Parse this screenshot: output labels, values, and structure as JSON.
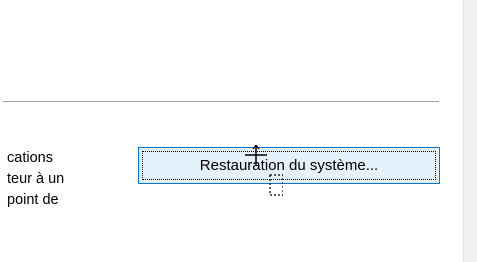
{
  "description": {
    "lines": [
      "cations",
      "teur à un",
      "point de"
    ]
  },
  "buttons": {
    "system_restore": "Restauration du système..."
  },
  "cursor": {
    "icon": "move-cursor-icon"
  }
}
